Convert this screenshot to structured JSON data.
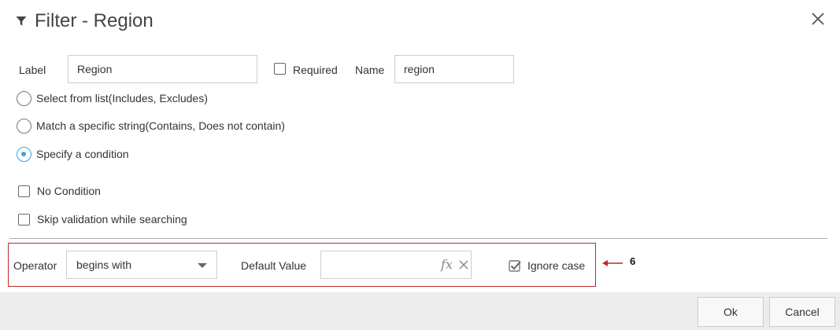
{
  "dialog": {
    "title": "Filter - Region",
    "title_icon": "filter-icon",
    "close_icon": "close-icon"
  },
  "fields": {
    "label_label": "Label",
    "label_value": "Region",
    "required_label": "Required",
    "required_checked": false,
    "name_label": "Name",
    "name_value": "region"
  },
  "options": [
    {
      "label": "Select from list(Includes, Excludes)",
      "selected": false
    },
    {
      "label": "Match a specific string(Contains, Does not contain)",
      "selected": false
    },
    {
      "label": "Specify a condition",
      "selected": true
    }
  ],
  "checkboxes": [
    {
      "label": "No Condition",
      "checked": false
    },
    {
      "label": "Skip validation while searching",
      "checked": false
    }
  ],
  "condition": {
    "operator_label": "Operator",
    "operator_value": "begins with",
    "default_value_label": "Default Value",
    "default_value": "",
    "fx_label": "fx",
    "ignore_case_label": "Ignore case",
    "ignore_case_checked": true
  },
  "annotation": {
    "number": "6",
    "color": "#c0272d"
  },
  "footer": {
    "ok_label": "Ok",
    "cancel_label": "Cancel"
  },
  "colors": {
    "accent": "#3aa3e3",
    "footer_bg": "#ececec"
  }
}
